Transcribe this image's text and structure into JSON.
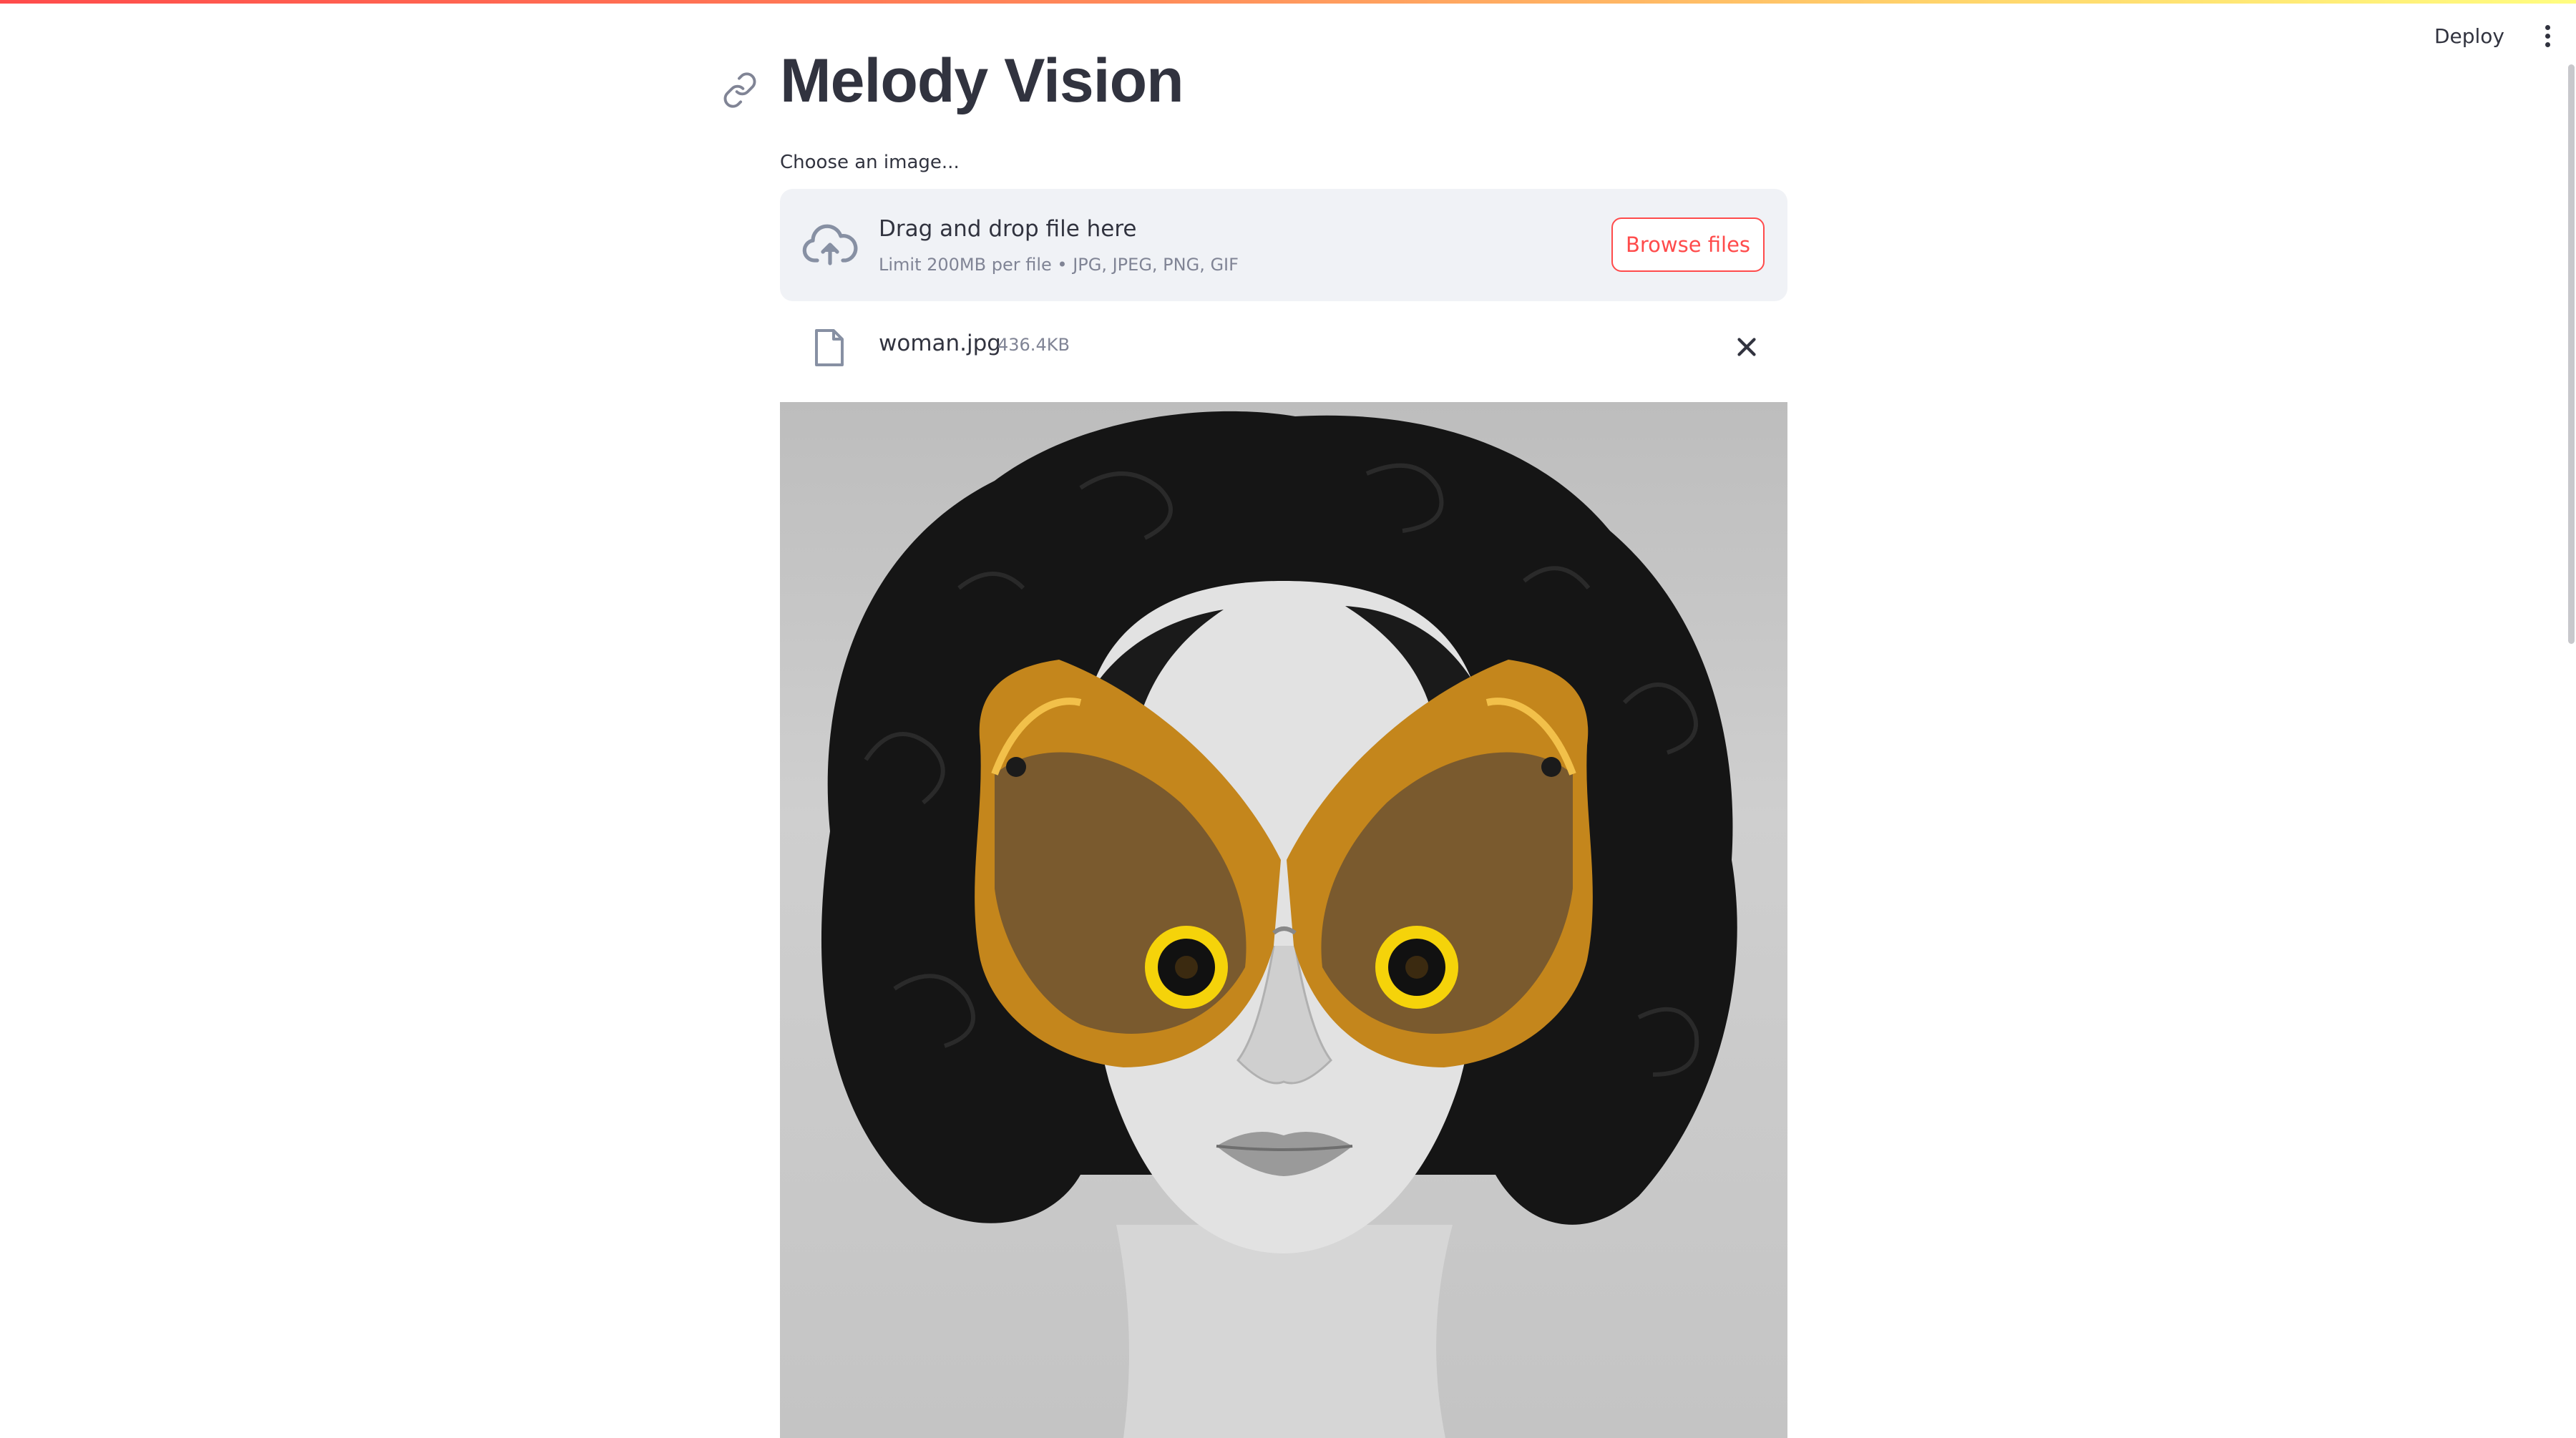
{
  "app": {
    "title": "Melody Vision",
    "deploy_label": "Deploy",
    "accent_color": "#ff4b4b"
  },
  "uploader": {
    "label": "Choose an image...",
    "drag_text": "Drag and drop file here",
    "limit_text": "Limit 200MB per file • JPG, JPEG, PNG, GIF",
    "browse_label": "Browse files"
  },
  "uploaded_file": {
    "name": "woman.jpg",
    "size": "436.4KB"
  },
  "icons": {
    "anchor": "link-icon",
    "menu": "kebab-menu-icon",
    "upload": "cloud-upload-icon",
    "file": "file-icon",
    "remove": "close-icon"
  }
}
